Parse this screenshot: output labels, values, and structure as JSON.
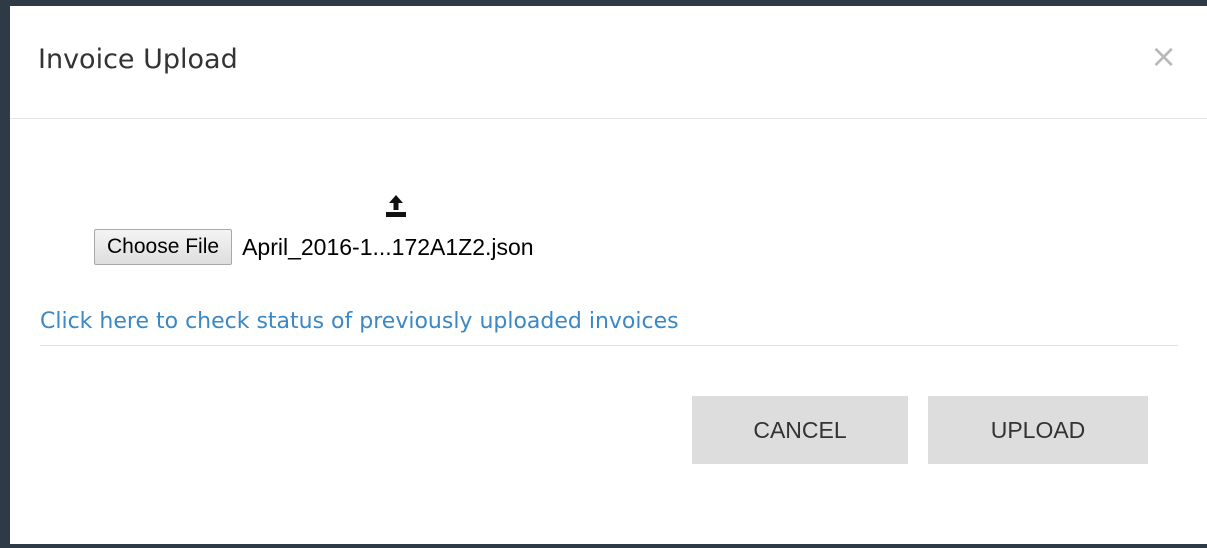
{
  "dialog": {
    "title": "Invoice Upload",
    "close_label": "×"
  },
  "file_input": {
    "button_label": "Choose File",
    "selected_file": "April_2016-1...172A1Z2.json"
  },
  "icons": {
    "upload": "upload-icon",
    "close": "close-icon"
  },
  "status_link": "Click here to check status of previously uploaded invoices",
  "actions": {
    "cancel_label": "CANCEL",
    "upload_label": "UPLOAD"
  },
  "colors": {
    "link": "#3a88c6",
    "button_bg": "#dddddd",
    "backdrop": "#2e3b46"
  }
}
